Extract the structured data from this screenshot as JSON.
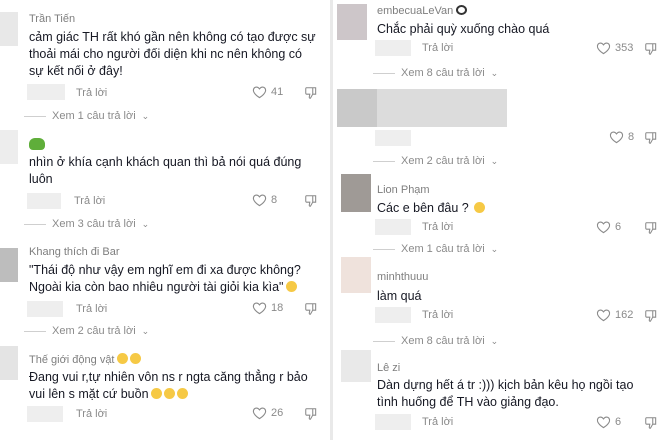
{
  "left": {
    "comments": [
      {
        "username": "Trần Tiến",
        "text": "cảm giác TH rất khó gần nên không có tạo được sự thoải mái cho người đối diện khi nc nên không có sự kết nối ở đây!",
        "reply": "Trả lời",
        "likes": "41"
      },
      {
        "username": "",
        "text": "nhìn ở khía cạnh khách quan thì bả nói quá đúng luôn",
        "reply": "Trả lời",
        "likes": "8"
      },
      {
        "username": "Khang thích đi Bar",
        "text": "\"Thái độ như vậy em nghĩ em đi xa được không? Ngoài kia còn bao nhiêu người tài giỏi kia kìa\"",
        "reply": "Trả lời",
        "likes": "18"
      },
      {
        "username": "Thế giới động vật",
        "text": "Đang vui r,tự nhiên vôn ns r ngta căng thẳng r bảo vui lên s mặt cứ buồn",
        "reply": "Trả lời",
        "likes": "26"
      }
    ],
    "view_more": [
      "Xem 1 câu trả lời",
      "Xem 3 câu trả lời",
      "Xem 2 câu trả lời"
    ]
  },
  "right": {
    "comments": [
      {
        "username": "embecuaLeVan",
        "text": "Chắc phải quỳ xuống chào quá",
        "reply": "Trả lời",
        "likes": "353"
      },
      {
        "username": "",
        "text": "",
        "reply": "",
        "likes": "8"
      },
      {
        "username": "Lion Phạm",
        "text": "Các e bên đâu ?",
        "reply": "Trả lời",
        "likes": "6"
      },
      {
        "username": "minhthuuu",
        "text": "làm quá",
        "reply": "Trả lời",
        "likes": "162"
      },
      {
        "username": "Lê zi",
        "text": "Dàn dựng hết á tr :))) kịch bản kêu họ ngồi tạo tình huống để TH vào giảng đạo.",
        "reply": "Trả lời",
        "likes": "6"
      }
    ],
    "view_more": [
      "Xem 8 câu trả lời",
      "Xem 2 câu trả lời",
      "Xem 1 câu trả lời",
      "Xem 8 câu trả lời"
    ]
  },
  "icons": {
    "like": "heart-outline-icon",
    "dislike": "thumbs-down-outline-icon",
    "expand": "chevron-down-icon"
  }
}
